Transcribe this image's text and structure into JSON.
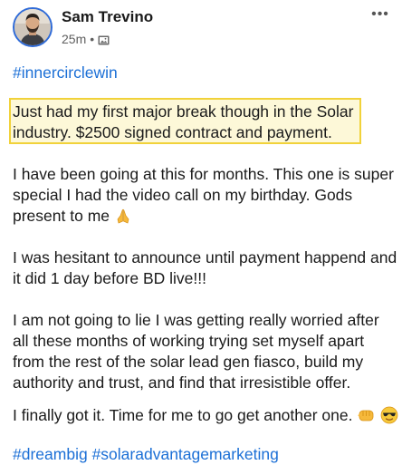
{
  "post": {
    "author": "Sam Trevino",
    "time": "25m",
    "dot": "•",
    "more_label": "•••",
    "top_hashtag": "#innercirclewin",
    "highlight": [
      "Just had my first major break though in the Solar",
      "industry. $2500 signed contract and payment."
    ],
    "paragraphs": {
      "p1": [
        "I have been going at this for months. This one is super",
        "special I had the video call on my birthday. Gods",
        "present to me"
      ],
      "p2": [
        "I was hesitant to announce until payment happend and",
        "it did 1 day before BD live!!!"
      ],
      "p3": [
        "I am not going to lie I was getting really worried after",
        "all these months of working trying set myself apart",
        "from the rest of the solar lead gen fiasco, build my",
        "authority and trust, and find that irresistible offer."
      ],
      "p4": "I finally got it. Time for me to go get another one."
    },
    "bottom_hashtags": [
      "#dreambig",
      "#solaradvantagemarketing"
    ],
    "emojis": [
      "folded-hands-icon",
      "fist-bump-icon",
      "sunglasses-smiley-icon"
    ],
    "colors": {
      "hashtag": "#1b6fd6",
      "highlight_border": "#f1d23a",
      "avatar_ring": "#2f6bd8"
    }
  }
}
